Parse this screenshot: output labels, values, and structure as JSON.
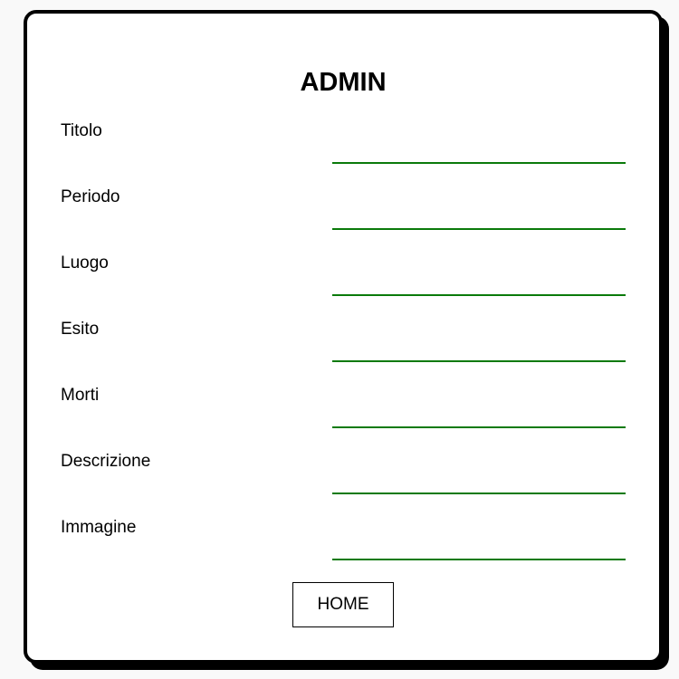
{
  "page": {
    "title": "ADMIN"
  },
  "form": {
    "fields": [
      {
        "label": "Titolo",
        "value": ""
      },
      {
        "label": "Periodo",
        "value": ""
      },
      {
        "label": "Luogo",
        "value": ""
      },
      {
        "label": "Esito",
        "value": ""
      },
      {
        "label": "Morti",
        "value": ""
      },
      {
        "label": "Descrizione",
        "value": ""
      },
      {
        "label": "Immagine",
        "value": ""
      }
    ]
  },
  "actions": {
    "home_label": "HOME"
  },
  "colors": {
    "input_underline": "#0a7a0a",
    "card_border": "#000000"
  }
}
